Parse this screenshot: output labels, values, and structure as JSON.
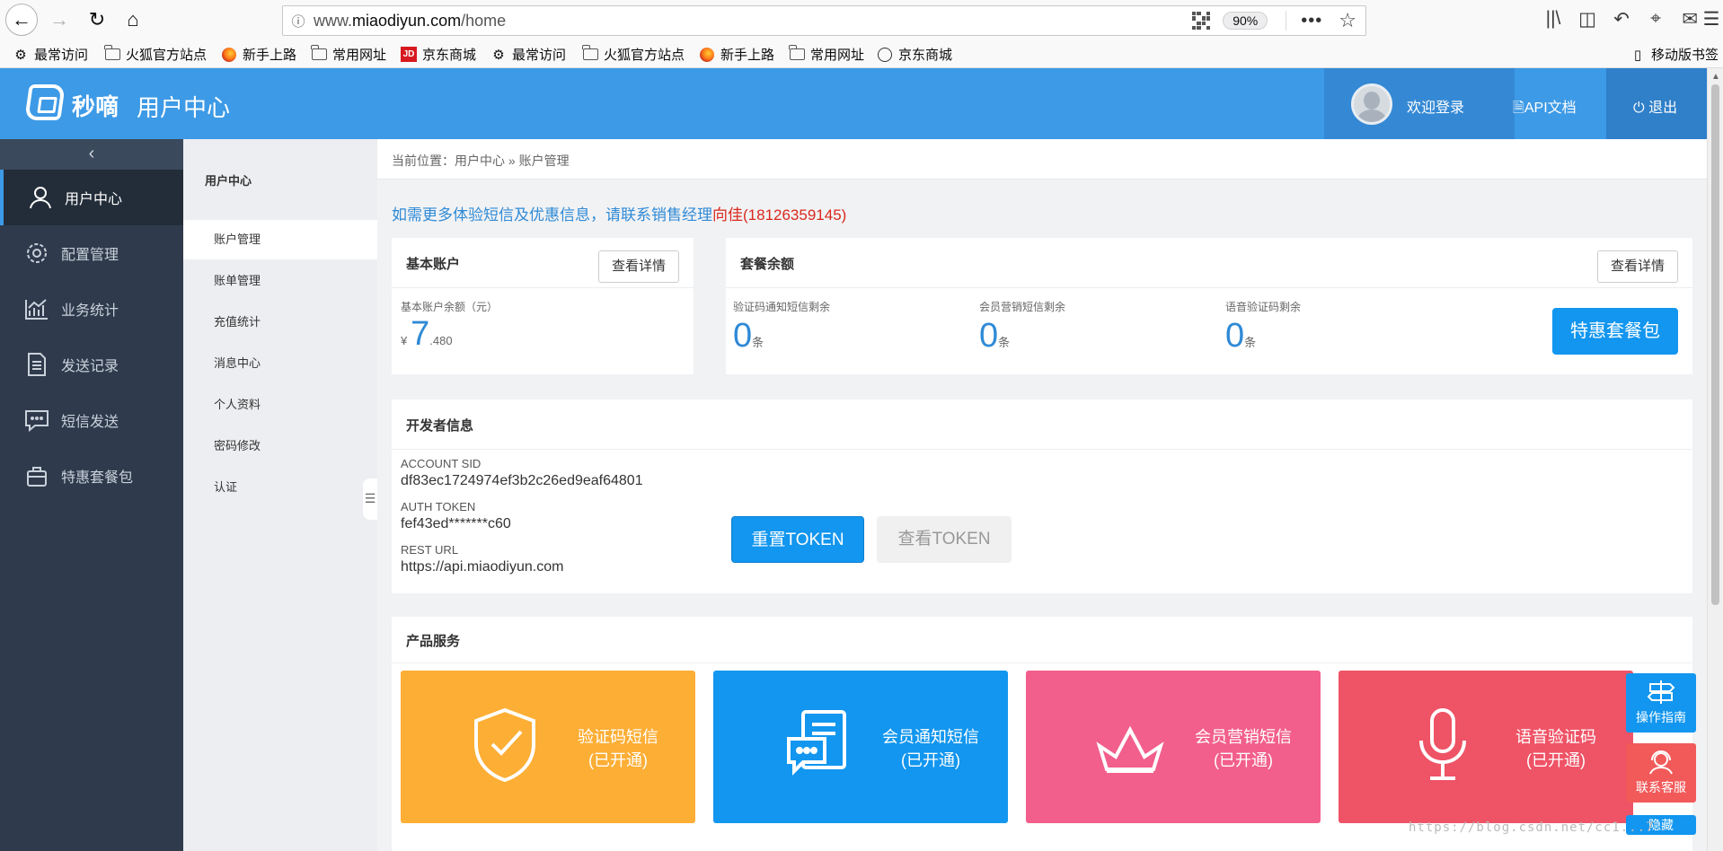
{
  "browser": {
    "url_prefix": "www.",
    "url_domain": "miaodiyun.com",
    "url_path": "/home",
    "zoom": "90%",
    "bookmarks": [
      {
        "label": "最常访问",
        "icon": "gear-icon"
      },
      {
        "label": "火狐官方站点",
        "icon": "folder-icon"
      },
      {
        "label": "新手上路",
        "icon": "firefox-icon"
      },
      {
        "label": "常用网址",
        "icon": "folder-icon"
      },
      {
        "label": "京东商城",
        "icon": "jd-icon",
        "badge": "JD"
      },
      {
        "label": "最常访问",
        "icon": "gear-icon"
      },
      {
        "label": "火狐官方站点",
        "icon": "folder-icon"
      },
      {
        "label": "新手上路",
        "icon": "firefox-icon"
      },
      {
        "label": "常用网址",
        "icon": "folder-icon"
      },
      {
        "label": "京东商城",
        "icon": "globe-icon"
      }
    ],
    "mobile_bookmarks": "移动版书签"
  },
  "header": {
    "logo_text": "秒嘀",
    "title": "用户中心",
    "welcome": "欢迎登录",
    "api_doc": "API文档",
    "logout": "退出",
    "colors": {
      "primary": "#3d9ae6",
      "user_bg": "#3589d4",
      "logout_bg": "#2f7fc9"
    }
  },
  "sidebar": {
    "items": [
      {
        "label": "用户中心",
        "icon": "user-icon",
        "active": true
      },
      {
        "label": "配置管理",
        "icon": "gear-icon"
      },
      {
        "label": "业务统计",
        "icon": "chart-icon"
      },
      {
        "label": "发送记录",
        "icon": "document-icon"
      },
      {
        "label": "短信发送",
        "icon": "message-icon"
      },
      {
        "label": "特惠套餐包",
        "icon": "bag-icon"
      }
    ]
  },
  "subnav": {
    "title": "用户中心",
    "items": [
      {
        "label": "账户管理",
        "active": true
      },
      {
        "label": "账单管理"
      },
      {
        "label": "充值统计"
      },
      {
        "label": "消息中心"
      },
      {
        "label": "个人资料"
      },
      {
        "label": "密码修改"
      },
      {
        "label": "认证"
      }
    ]
  },
  "main": {
    "breadcrumb": "当前位置：用户中心 » 账户管理",
    "promo_text": "如需更多体验短信及优惠信息，请联系销售经理",
    "promo_contact": "向佳(18126359145)",
    "basic_account": {
      "title": "基本账户",
      "detail_btn": "查看详情",
      "balance_label": "基本账户余额（元）",
      "currency": "¥",
      "balance_int": "7",
      "balance_dec": ".480"
    },
    "package": {
      "title": "套餐余额",
      "detail_btn": "查看详情",
      "items": [
        {
          "label": "验证码通知短信剩余",
          "value": "0",
          "unit": "条"
        },
        {
          "label": "会员营销短信剩余",
          "value": "0",
          "unit": "条"
        },
        {
          "label": "语音验证码剩余",
          "value": "0",
          "unit": "条"
        }
      ],
      "special_btn": "特惠套餐包"
    },
    "developer": {
      "title": "开发者信息",
      "account_sid_label": "ACCOUNT SID",
      "account_sid": "df83ec1724974ef3b2c26ed9eaf64801",
      "auth_token_label": "AUTH TOKEN",
      "auth_token": "fef43ed*******c60",
      "rest_url_label": "REST URL",
      "rest_url": "https://api.miaodiyun.com",
      "reset_btn": "重置TOKEN",
      "view_btn": "查看TOKEN"
    },
    "products": {
      "title": "产品服务",
      "items": [
        {
          "name": "验证码短信",
          "status": "(已开通)",
          "color": "#fdae35",
          "icon": "shield-check-icon"
        },
        {
          "name": "会员通知短信",
          "status": "(已开通)",
          "color": "#1296ef",
          "icon": "chat-document-icon"
        },
        {
          "name": "会员营销短信",
          "status": "(已开通)",
          "color": "#f25f8c",
          "icon": "crown-icon"
        },
        {
          "name": "语音验证码",
          "status": "(已开通)",
          "color": "#ef5366",
          "icon": "microphone-icon"
        }
      ]
    }
  },
  "floating": {
    "guide": "操作指南",
    "service": "联系客服",
    "hide": "隐藏"
  },
  "watermark": "https://blog.csdn.net/cc1...7"
}
